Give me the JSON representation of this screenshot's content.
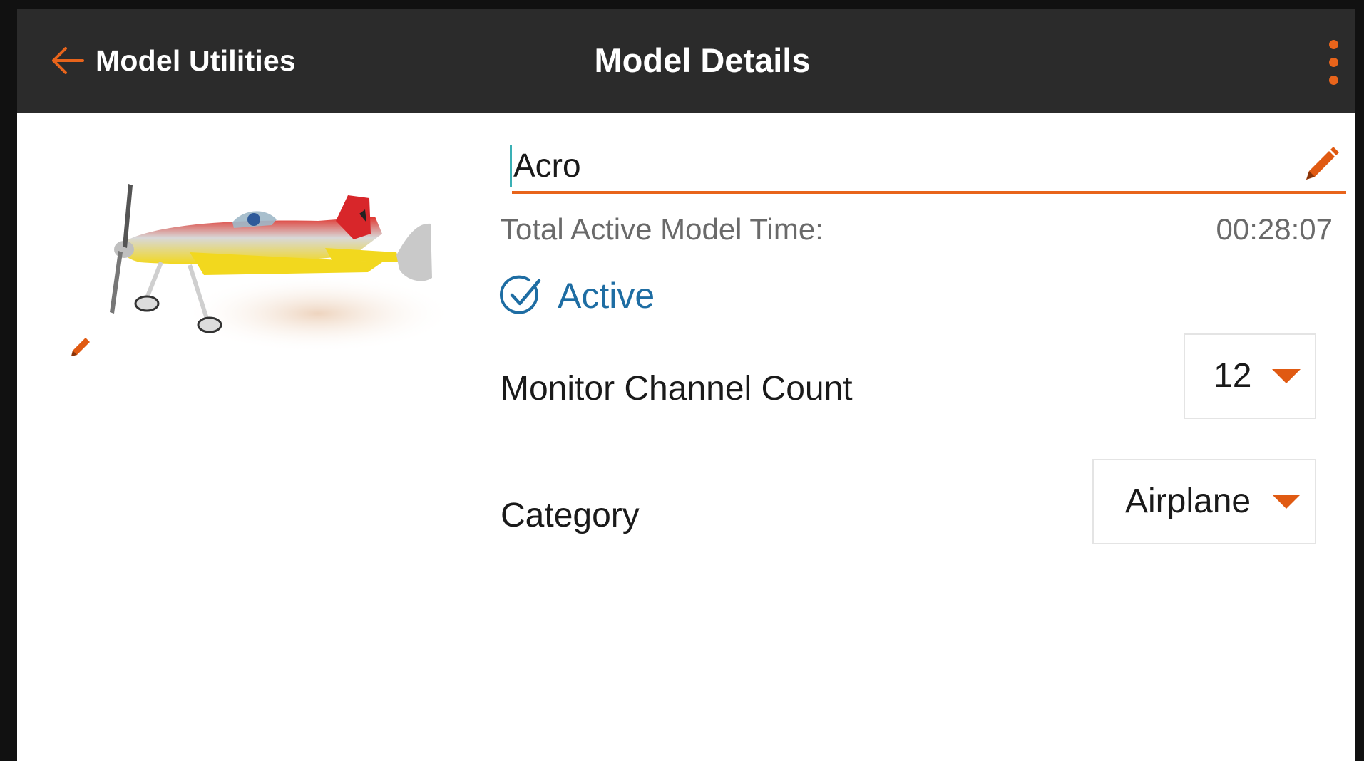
{
  "header": {
    "back_label": "Model Utilities",
    "title": "Model Details"
  },
  "model": {
    "name": "Acro",
    "time_label": "Total Active Model Time:",
    "time_value": "00:28:07",
    "active_label": "Active",
    "active_checked": true
  },
  "settings": {
    "channel_count_label": "Monitor Channel Count",
    "channel_count_value": "12",
    "category_label": "Category",
    "category_value": "Airplane"
  },
  "colors": {
    "header_bg": "#2b2b2b",
    "accent_orange": "#e8641b",
    "active_blue": "#1e6da3",
    "caret_teal": "#3ab0b5"
  },
  "icons": {
    "back": "arrow-left-icon",
    "menu": "more-vertical-icon",
    "edit": "pencil-icon",
    "active": "check-circle-icon",
    "dropdown": "caret-down-icon"
  }
}
